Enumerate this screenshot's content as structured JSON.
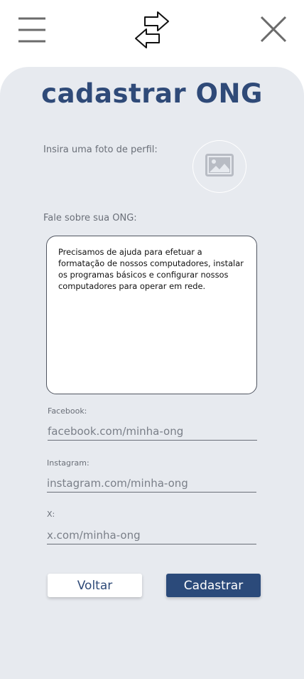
{
  "header": {
    "menu_icon": "hamburger-menu-icon",
    "logo_icon": "swap-arrows-logo-icon",
    "close_icon": "close-x-icon"
  },
  "page": {
    "title": "cadastrar ONG"
  },
  "photo": {
    "label": "Insira uma foto de perfil:",
    "icon": "image-placeholder-icon"
  },
  "about": {
    "label": "Fale sobre sua ONG:",
    "text": "Precisamos de ajuda para efetuar a formatação de nossos computadores, instalar os programas básicos e configurar nossos computadores para operar em rede."
  },
  "social": {
    "facebook": {
      "label": "Facebook:",
      "placeholder": "facebook.com/minha-ong"
    },
    "instagram": {
      "label": "Instagram:",
      "placeholder": "instagram.com/minha-ong"
    },
    "x": {
      "label": "X:",
      "placeholder": "x.com/minha-ong"
    }
  },
  "actions": {
    "back_label": "Voltar",
    "submit_label": "Cadastrar"
  },
  "colors": {
    "brand": "#2f4a78",
    "panel_bg": "#e7eaef",
    "primary_button": "#2b4a7a"
  }
}
